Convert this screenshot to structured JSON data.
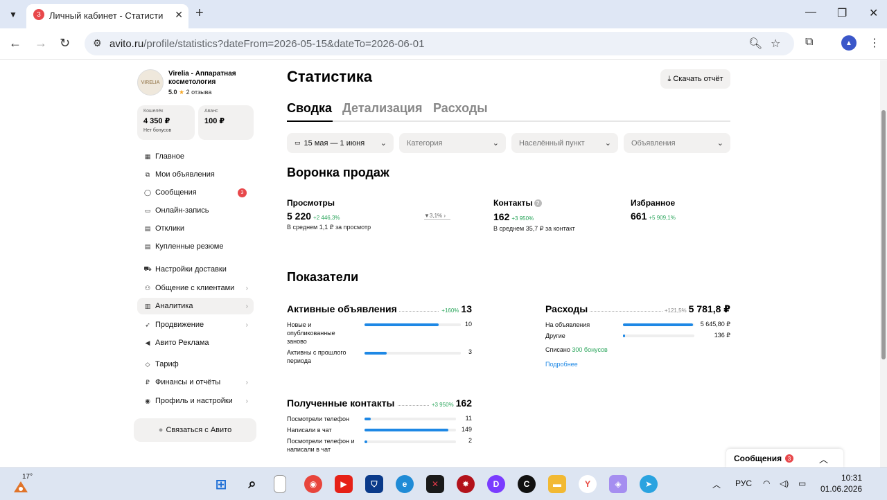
{
  "browser": {
    "tab_badge": "3",
    "tab_title": "Личный кабинет - Статистика",
    "url_host": "avito.ru",
    "url_path": "/profile/statistics?dateFrom=2026-05-15&dateTo=2026-06-01"
  },
  "shop": {
    "name": "Virelia - Аппаратная косметология",
    "logo_text": "VIRELIA",
    "rating": "5.0",
    "reviews": "2 отзыва"
  },
  "wallet": {
    "label": "Кошелёк",
    "value": "4 350 ₽",
    "sub": "Нет бонусов"
  },
  "advance": {
    "label": "Аванс",
    "value": "100 ₽"
  },
  "sidebar": {
    "items": [
      {
        "label": "Главное",
        "icon": "grid-icon"
      },
      {
        "label": "Мои объявления",
        "icon": "copy-icon"
      },
      {
        "label": "Сообщения",
        "icon": "chat-icon",
        "badge": "3"
      },
      {
        "label": "Онлайн-запись",
        "icon": "calendar-icon"
      },
      {
        "label": "Отклики",
        "icon": "doc-icon"
      },
      {
        "label": "Купленные резюме",
        "icon": "doc-icon"
      },
      {
        "label": "Настройки доставки",
        "icon": "truck-icon"
      },
      {
        "label": "Общение с клиентами",
        "icon": "people-icon"
      },
      {
        "label": "Аналитика",
        "icon": "chart-icon"
      },
      {
        "label": "Продвижение",
        "icon": "rocket-icon"
      },
      {
        "label": "Авито Реклама",
        "icon": "megaphone-icon"
      },
      {
        "label": "Тариф",
        "icon": "diamond-icon"
      },
      {
        "label": "Финансы и отчёты",
        "icon": "ruble-icon"
      },
      {
        "label": "Профиль и настройки",
        "icon": "user-icon"
      }
    ],
    "contact_button": "Связаться с Авито"
  },
  "main": {
    "title": "Статистика",
    "download_button": "Скачать отчёт",
    "tabs": [
      "Сводка",
      "Детализация",
      "Расходы"
    ],
    "filters": {
      "period": "15 мая — 1 июня",
      "category": "Категория",
      "city": "Населённый пункт",
      "ads": "Объявления"
    }
  },
  "funnel": {
    "title": "Воронка продаж",
    "views": {
      "label": "Просмотры",
      "value": "5 220",
      "change": "+2 446,3%",
      "sub": "В среднем 1,1 ₽ за просмотр"
    },
    "conversion": "3,1%",
    "contacts": {
      "label": "Контакты",
      "value": "162",
      "change": "+3 950%",
      "sub": "В среднем 35,7 ₽ за контакт"
    },
    "favorites": {
      "label": "Избранное",
      "value": "661",
      "change": "+5 909,1%"
    }
  },
  "indicators": {
    "title": "Показатели",
    "active_ads": {
      "title": "Активные объявления",
      "change": "+160%",
      "total": "13",
      "rows": [
        {
          "label": "Новые и опубликованные заново",
          "value": "10",
          "share": 0.77
        },
        {
          "label": "Активны с прошлого периода",
          "value": "3",
          "share": 0.23
        }
      ]
    },
    "expenses": {
      "title": "Расходы",
      "change": "+121,5%",
      "total": "5 781,8 ₽",
      "rows": [
        {
          "label": "На объявления",
          "value": "5 645,80 ₽",
          "share": 0.98
        },
        {
          "label": "Другие",
          "value": "136 ₽",
          "share": 0.02
        }
      ],
      "written_off": "Списано",
      "bonuses": "300 бонусов",
      "more_link": "Подробнее"
    },
    "contacts": {
      "title": "Полученные контакты",
      "change": "+3 950%",
      "total": "162",
      "rows": [
        {
          "label": "Посмотрели телефон",
          "value": "11",
          "share": 0.07
        },
        {
          "label": "Написали в чат",
          "value": "149",
          "share": 0.92
        },
        {
          "label": "Посмотрели телефон и написали в чат",
          "value": "2",
          "share": 0.02
        }
      ]
    }
  },
  "messages_panel": {
    "title": "Сообщения",
    "badge": "3"
  },
  "taskbar": {
    "temperature": "17°",
    "language": "РУС",
    "time": "10:31",
    "date": "01.06.2026"
  },
  "colors": {
    "accent": "#1e88e5",
    "positive": "#2aa55b",
    "badge": "#e8484b"
  }
}
